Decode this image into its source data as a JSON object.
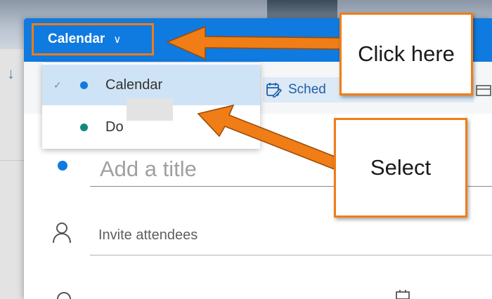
{
  "header": {
    "calendar_selector_label": "Calendar",
    "chevron_icon": "chevron-down-icon",
    "color": "#0f7ae0"
  },
  "toolbar": {
    "schedule_label": "Sched",
    "schedule_icon": "calendar-edit-icon"
  },
  "dropdown": {
    "items": [
      {
        "label": "Calendar",
        "dot_color": "#0f7ae0",
        "checked": true
      },
      {
        "label": "Do",
        "dot_color": "#128a7b",
        "checked": false
      }
    ]
  },
  "form": {
    "title_placeholder": "Add a title",
    "invite_placeholder": "Invite attendees"
  },
  "annotations": {
    "click_here": "Click here",
    "select": "Select",
    "accent": "#f07d16"
  }
}
